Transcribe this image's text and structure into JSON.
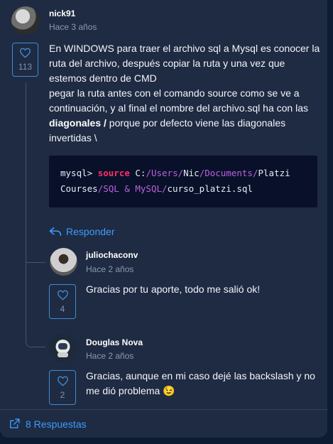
{
  "comment": {
    "username": "nick91",
    "time": "Hace 3 años",
    "likes": "113",
    "text_intro": "En WINDOWS para traer el archivo sql a Mysql es conocer la ruta del archivo, después copiar la ruta y una vez que estemos dentro de CMD",
    "text_line2": "pegar la ruta antes con el comando source como se ve a continuación, y al final el nombre del archivo.sql ha con las",
    "text_bold": "diagonales /",
    "text_after_bold": " porque por defecto viene las diagonales invertidas \\",
    "code": {
      "prompt": "mysql>",
      "keyword": "source",
      "drive": "C:",
      "path1": "/Users/",
      "seg1": "Nic",
      "path2": "/Documents/",
      "seg2": "Platzi",
      "seg3": "Courses",
      "path3": "/SQL & MySQL/",
      "file": "curso_platzi.sql"
    },
    "reply_label": "Responder"
  },
  "replies": [
    {
      "username": "juliochaconv",
      "time": "Hace 2 años",
      "likes": "4",
      "text": "Gracias por tu aporte, todo me salió ok!"
    },
    {
      "username": "Douglas Nova",
      "time": "Hace 2 años",
      "likes": "2",
      "text": "Gracias, aunque en mi caso dejé las backslash y no me dió problema 😉"
    }
  ],
  "footer": {
    "label": "8 Respuestas"
  },
  "colors": {
    "accent": "#3b9cff",
    "keyword": "#ff2d66",
    "path": "#c05fe0",
    "card": "#1f2b42"
  }
}
